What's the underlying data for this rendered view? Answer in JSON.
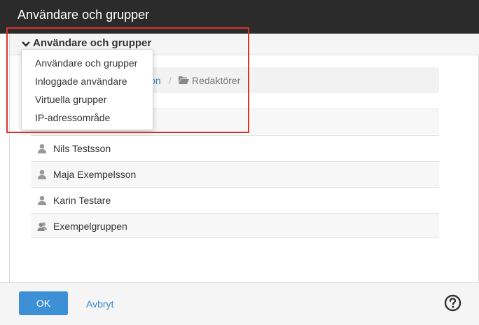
{
  "dialog": {
    "title": "Användare och grupper"
  },
  "section": {
    "label": "Användare och grupper"
  },
  "dropdown": {
    "items": [
      "Användare och grupper",
      "Inloggade användare",
      "Virtuella grupper",
      "IP-adressområde"
    ]
  },
  "breadcrumb": {
    "first_partial": "sion",
    "separator": "/",
    "current": "Redaktörer"
  },
  "members": [
    {
      "name": "",
      "type": "user"
    },
    {
      "name": "Nils Testsson",
      "type": "user"
    },
    {
      "name": "Maja Exempelsson",
      "type": "user"
    },
    {
      "name": "Karin Testare",
      "type": "user"
    },
    {
      "name": "Exempelgruppen",
      "type": "group"
    }
  ],
  "footer": {
    "ok_label": "OK",
    "cancel_label": "Avbryt"
  },
  "colors": {
    "accent": "#3d8fd6",
    "highlight": "#d9342b",
    "titlebar": "#2b2b2b"
  }
}
